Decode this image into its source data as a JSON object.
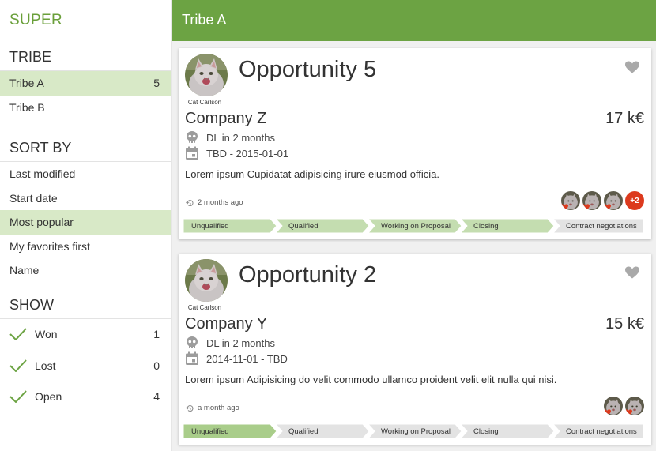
{
  "app": {
    "brand": "SUPER"
  },
  "header": {
    "title": "Tribe A"
  },
  "sidebar": {
    "tribe_title": "TRIBE",
    "tribes": [
      {
        "label": "Tribe A",
        "count": "5",
        "active": true
      },
      {
        "label": "Tribe B",
        "count": "",
        "active": false
      }
    ],
    "sort_title": "SORT BY",
    "sort_items": [
      {
        "label": "Last modified",
        "active": false
      },
      {
        "label": "Start date",
        "active": false
      },
      {
        "label": "Most popular",
        "active": true
      },
      {
        "label": "My favorites first",
        "active": false
      },
      {
        "label": "Name",
        "active": false
      }
    ],
    "show_title": "SHOW",
    "show_items": [
      {
        "label": "Won",
        "count": "1",
        "checked": true
      },
      {
        "label": "Lost",
        "count": "0",
        "checked": true
      },
      {
        "label": "Open",
        "count": "4",
        "checked": true
      }
    ]
  },
  "stages": [
    "Unqualified",
    "Qualified",
    "Working on Proposal",
    "Closing",
    "Contract negotiations"
  ],
  "cards": [
    {
      "owner": "Cat Carlson",
      "title": "Opportunity 5",
      "company": "Company Z",
      "amount": "17 k€",
      "deadline": "DL in 2 months",
      "dates": "TBD - 2015-01-01",
      "description": "Lorem ipsum Cupidatat adipisicing irure eiusmod officia.",
      "updated": "2 months ago",
      "peers_more": "+2",
      "stage_reached": 4
    },
    {
      "owner": "Cat Carlson",
      "title": "Opportunity 2",
      "company": "Company Y",
      "amount": "15 k€",
      "deadline": "DL in 2 months",
      "dates": "2014-11-01 - TBD",
      "description": "Lorem ipsum Adipisicing do velit commodo ullamco proident velit elit nulla qui nisi.",
      "updated": "a month ago",
      "peers_more": "",
      "stage_reached": 1
    }
  ],
  "colors": {
    "brand": "#6ca343",
    "active_bg": "#d8e9c7",
    "stage_done": "#c4ddb0",
    "stage_current": "#a9cd8a",
    "stage_todo": "#e3e3e3",
    "badge": "#dc3a1e"
  }
}
